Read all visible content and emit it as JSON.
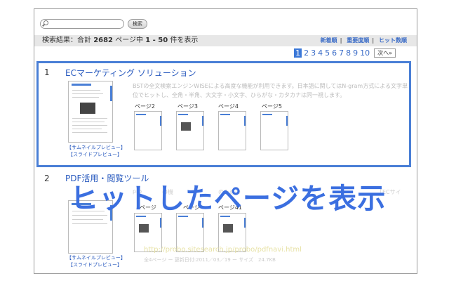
{
  "search": {
    "placeholder": "",
    "button_label": "検索"
  },
  "results_header": {
    "prefix": "検索結果：合計",
    "total": "2682",
    "middle": "ページ中",
    "range": "1 - 50",
    "suffix": "件を表示",
    "sort_links": [
      "新着順",
      "重要度順",
      "ヒット数順"
    ]
  },
  "pagination": {
    "pages": [
      "1",
      "2",
      "3",
      "4",
      "5",
      "6",
      "7",
      "8",
      "9",
      "10"
    ],
    "active": "1",
    "next_label": "次へ»"
  },
  "results": [
    {
      "number": "1",
      "title": "ECマーケティング ソリューション",
      "snippet": "BSTの全文検索エンジンWISEによる高度な機能が利用できます。日本語に関してはN-gram方式による文字単位でヒットし、全角・半角、大文字・小文字、ひらがな・カタカナは同一視します。",
      "preview_links": [
        "【サムネイルプレビュー】",
        "【スライドプレビュー】"
      ],
      "page_thumbs": [
        "ページ2",
        "ページ3",
        "ページ4",
        "ページ5"
      ]
    },
    {
      "number": "2",
      "title": "PDF活用・閲覧ツール",
      "preview_links": [
        "【サムネイルプレビュー】",
        "【スライドプレビュー】"
      ],
      "page_thumbs": [
        "ページ",
        "ページ",
        "ページ41"
      ],
      "snippet_fragments": [
        "pro",
        "の機",
        "のための",
        "「ECサイ"
      ],
      "url": "http://probo.sitesearch.jp/probo/pdfnavi.html",
      "meta": "全4ページ ー 更新日付:2011／03／19 ー サイズ　24.7KB"
    }
  ],
  "overlay_caption": "ヒットしたページを表示",
  "colors": {
    "accent": "#3b6fe0",
    "link": "#2a5bbf",
    "highlight_border": "#4a7fd6"
  }
}
